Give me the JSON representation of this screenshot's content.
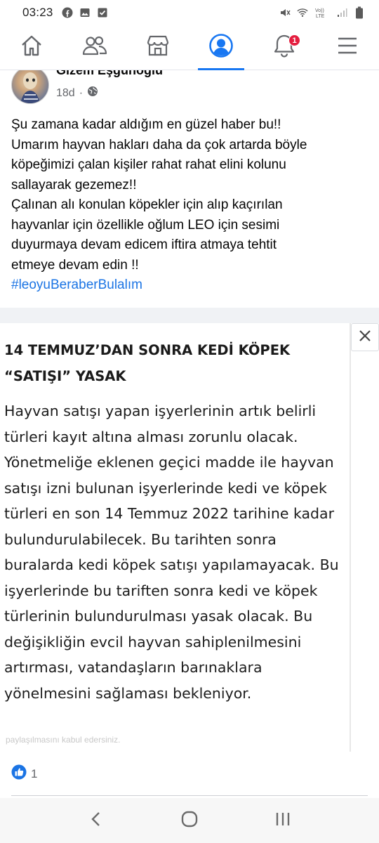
{
  "status_bar": {
    "time": "03:23",
    "icons_left": [
      "facebook-icon",
      "gallery-icon",
      "download-check-icon"
    ],
    "icons_right": [
      "mute-icon",
      "wifi-icon",
      "volte-icon",
      "signal-icon",
      "battery-icon"
    ],
    "volte_label": "Vo)) LTE"
  },
  "nav": {
    "items": [
      {
        "name": "home-icon",
        "active": false
      },
      {
        "name": "friends-icon",
        "active": false
      },
      {
        "name": "marketplace-icon",
        "active": false
      },
      {
        "name": "profile-icon",
        "active": true
      },
      {
        "name": "notifications-icon",
        "active": false,
        "badge": "1"
      },
      {
        "name": "menu-icon",
        "active": false
      }
    ],
    "accent": "#1877f2"
  },
  "post": {
    "author": "Gizem Eşgünoğlu",
    "time": "18d",
    "separator": "·",
    "privacy_icon": "globe-icon",
    "text_lines": [
      "Şu zamana kadar aldığım en güzel haber bu!!",
      "Umarım hayvan hakları daha da çok artarda böyle",
      "köpeğimizi çalan kişiler rahat rahat elini kolunu",
      "sallayarak gezemez!!",
      "Çalınan alı konulan köpekler için alıp kaçırılan",
      "hayvanlar için özellikle oğlum  LEO için  sesimi",
      "duyurmaya devam edicem iftira atmaya tehtit",
      "etmeye devam edin !!"
    ],
    "hashtag": "#leoyuBeraberBulalım"
  },
  "article": {
    "title_lines": [
      "14 TEMMUZ’DAN SONRA KEDİ KÖPEK",
      "“SATIŞI” YASAK"
    ],
    "body_lines": [
      "Hayvan satışı yapan işyerlerinin artık belirli",
      "türleri kayıt altına alması zorunlu olacak.",
      "Yönetmeliğe eklenen geçici madde ile hayvan",
      "satışı izni bulunan işyerlerinde kedi ve köpek",
      "türleri en son 14 Temmuz 2022 tarihine kadar",
      "bulundurulabilecek. Bu tarihten sonra",
      "buralarda kedi köpek satışı yapılamayacak. Bu",
      "işyerlerinde bu tariften sonra kedi ve köpek",
      "türlerinin bulundurulması yasak olacak. Bu",
      "değişikliğin evcil hayvan sahiplenilmesini",
      "artırması, vatandaşların barınaklara",
      "yönelmesini sağlaması bekleniyor."
    ],
    "faded_footer": "paylaşılmasını kabul edersiniz."
  },
  "reactions": {
    "icon": "like-icon",
    "count": "1"
  },
  "android_nav": [
    "back-icon",
    "home-circle-icon",
    "recents-icon"
  ]
}
